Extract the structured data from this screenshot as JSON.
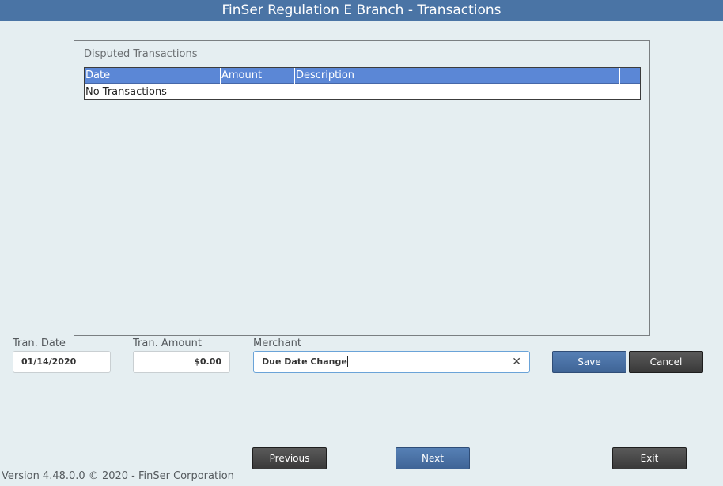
{
  "window": {
    "title": "FinSer Regulation E Branch - Transactions"
  },
  "disputed": {
    "title": "Disputed Transactions",
    "columns": [
      "Date",
      "Amount",
      "Description",
      ""
    ],
    "empty_text": "No Transactions"
  },
  "form": {
    "tran_date": {
      "label": "Tran. Date",
      "value": "01/14/2020"
    },
    "tran_amount": {
      "label": "Tran. Amount",
      "value": "$0.00"
    },
    "merchant": {
      "label": "Merchant",
      "value": "Due Date Change"
    },
    "save_label": "Save",
    "cancel_label": "Cancel"
  },
  "nav": {
    "previous_label": "Previous",
    "next_label": "Next",
    "exit_label": "Exit"
  },
  "footer": {
    "version": "Version 4.48.0.0 © 2020 - FinSer Corporation"
  },
  "icons": {
    "clear": "close-icon"
  },
  "colors": {
    "titlebar": "#4a74a5",
    "grid_header": "#5b87d6",
    "primary_button": "#4a6fa3",
    "secondary_button": "#444444",
    "background": "#e5eef1"
  }
}
